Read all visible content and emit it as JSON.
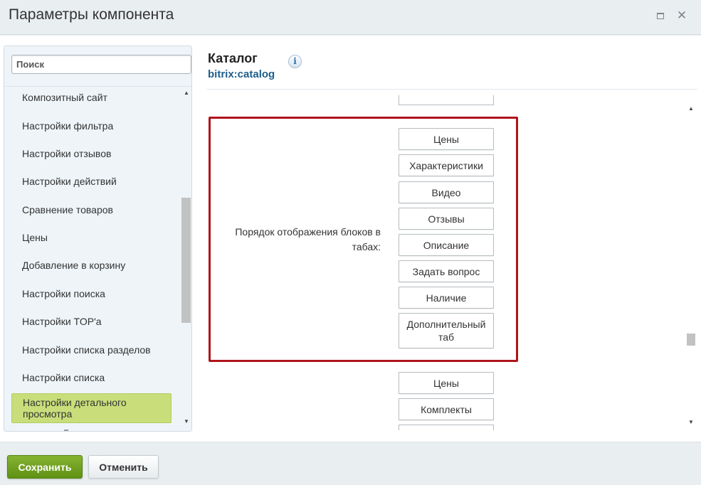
{
  "window": {
    "title": "Параметры компонента",
    "maximize_icon": "maximize-icon",
    "close_icon": "close-icon"
  },
  "sidebar": {
    "search_placeholder": "Поиск",
    "items": [
      {
        "label": "Композитный сайт"
      },
      {
        "label": "Настройки фильтра"
      },
      {
        "label": "Настройки отзывов"
      },
      {
        "label": "Настройки действий"
      },
      {
        "label": "Сравнение товаров"
      },
      {
        "label": "Цены"
      },
      {
        "label": "Добавление в корзину"
      },
      {
        "label": "Настройки поиска"
      },
      {
        "label": "Настройки TOP'а"
      },
      {
        "label": "Настройки списка разделов"
      },
      {
        "label": "Настройки списка"
      },
      {
        "label": "Настройки детального просмотра",
        "active": true
      }
    ]
  },
  "component": {
    "title": "Каталог",
    "code": "bitrix:catalog",
    "info_icon": "info-icon"
  },
  "tab_order": {
    "label": "Порядок отображения блоков в табах:",
    "blocks": [
      {
        "label": "Цены"
      },
      {
        "label": "Характеристики"
      },
      {
        "label": "Видео"
      },
      {
        "label": "Отзывы"
      },
      {
        "label": "Описание"
      },
      {
        "label": "Задать вопрос"
      },
      {
        "label": "Наличие"
      },
      {
        "label": "Дополнительный таб"
      }
    ]
  },
  "next_field": {
    "blocks": [
      {
        "label": "Цены"
      },
      {
        "label": "Комплекты"
      }
    ]
  },
  "footer": {
    "save_label": "Сохранить",
    "cancel_label": "Отменить"
  },
  "colors": {
    "accent_green": "#6fa01f",
    "active_item": "#c9de7a",
    "highlight_border": "#b0141b",
    "link_blue": "#1e5e8c"
  }
}
